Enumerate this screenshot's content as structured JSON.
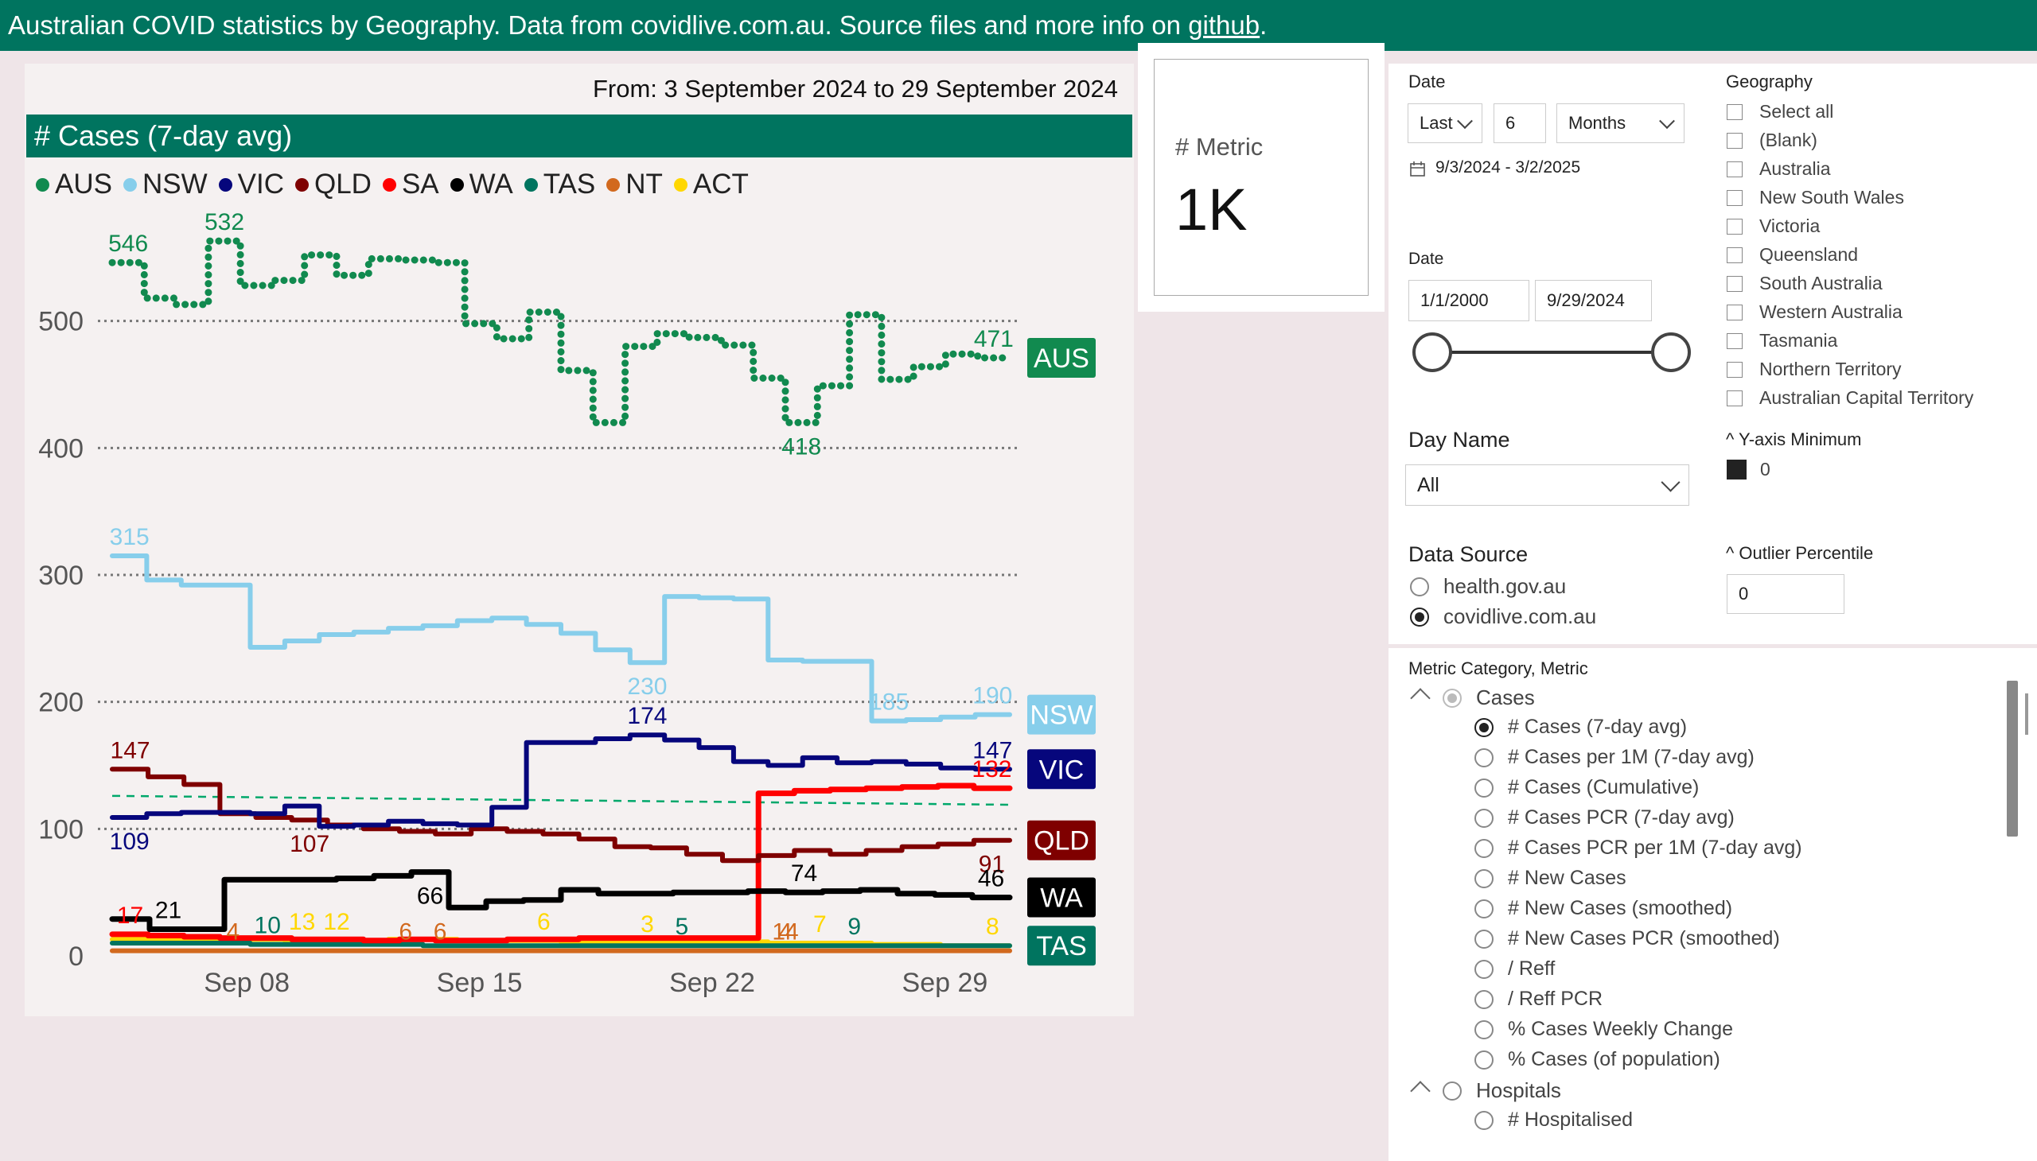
{
  "header": {
    "text_before_link": "Australian COVID statistics by Geography. Data from covidlive.com.au. Source files and more info on ",
    "link_text": "github",
    "text_after_link": "."
  },
  "chart": {
    "from_text": "From: 3 September 2024 to 29 September 2024",
    "title": "# Cases (7-day avg)"
  },
  "chart_data": {
    "type": "line",
    "title": "# Cases (7-day avg)",
    "xlabel": "",
    "ylabel": "",
    "x_ticks": [
      "Sep 08",
      "Sep 15",
      "Sep 22",
      "Sep 29"
    ],
    "y_ticks": [
      0,
      100,
      200,
      300,
      400,
      500
    ],
    "ylim": [
      0,
      600
    ],
    "grid": true,
    "legend_placement": "top",
    "reference_line": {
      "color": "#00a86b",
      "style": "dashed",
      "values": [
        126,
        119
      ]
    },
    "series": [
      {
        "name": "AUS",
        "color": "#118a4f",
        "values": [
          546,
          518,
          513,
          563,
          528,
          532,
          552,
          536,
          549,
          548,
          546,
          498,
          486,
          507,
          461,
          420,
          480,
          490,
          487,
          481,
          455,
          420,
          449,
          505,
          454,
          464,
          474,
          471
        ],
        "labels": [
          [
            0,
            "546"
          ],
          [
            3,
            "532"
          ],
          [
            21,
            "418"
          ],
          [
            27,
            "471"
          ]
        ],
        "end_label": "AUS"
      },
      {
        "name": "NSW",
        "color": "#87ceeb",
        "values": [
          315,
          296,
          292,
          292,
          243,
          248,
          253,
          255,
          258,
          260,
          264,
          266,
          261,
          254,
          241,
          231,
          283,
          282,
          281,
          233,
          232,
          232,
          185,
          186,
          188,
          190
        ],
        "labels": [
          [
            0,
            "315"
          ],
          [
            15,
            "230"
          ],
          [
            22,
            "185"
          ],
          [
            25,
            "190"
          ]
        ],
        "end_label": "NSW"
      },
      {
        "name": "VIC",
        "color": "#06067c",
        "values": [
          109,
          112,
          113,
          113,
          112,
          118,
          102,
          103,
          106,
          104,
          103,
          117,
          168,
          168,
          171,
          174,
          170,
          164,
          153,
          150,
          156,
          152,
          153,
          151,
          148,
          147
        ],
        "labels": [
          [
            0,
            "109"
          ],
          [
            15,
            "174"
          ],
          [
            25,
            "147"
          ]
        ],
        "end_label": "VIC"
      },
      {
        "name": "QLD",
        "color": "#7f0000",
        "values": [
          147,
          141,
          135,
          112,
          109,
          107,
          103,
          100,
          98,
          96,
          100,
          98,
          96,
          92,
          86,
          85,
          80,
          75,
          79,
          83,
          80,
          83,
          86,
          88,
          91
        ],
        "labels": [
          [
            0,
            "147"
          ],
          [
            5,
            "107"
          ],
          [
            24,
            "91"
          ]
        ],
        "end_label": "QLD"
      },
      {
        "name": "SA",
        "color": "#ff0000",
        "values": [
          17,
          16,
          15,
          14,
          14,
          13,
          13,
          12,
          13,
          12,
          12,
          13,
          13,
          14,
          14,
          14,
          14,
          14,
          128,
          130,
          131,
          132,
          133,
          134,
          132
        ],
        "labels": [
          [
            0,
            "17"
          ],
          [
            24,
            "132"
          ]
        ]
      },
      {
        "name": "WA",
        "color": "#000000",
        "values": [
          29,
          21,
          21,
          60,
          60,
          60,
          61,
          63,
          66,
          38,
          43,
          44,
          52,
          49,
          49,
          50,
          50,
          51,
          50,
          51,
          52,
          49,
          48,
          46
        ],
        "labels": [
          [
            1,
            "21"
          ],
          [
            8,
            "66"
          ],
          [
            18,
            "74"
          ],
          [
            23,
            "46"
          ]
        ],
        "end_label": "WA"
      },
      {
        "name": "TAS",
        "color": "#00745f",
        "values": [
          10,
          10,
          10,
          10,
          9,
          9,
          9,
          9,
          9,
          8,
          8,
          8,
          8,
          8,
          8,
          8,
          8,
          8,
          8,
          8,
          8,
          8,
          8,
          8,
          8,
          8
        ],
        "labels": [
          [
            4,
            "10"
          ],
          [
            16,
            "5"
          ],
          [
            21,
            "9"
          ]
        ],
        "end_label": "TAS"
      },
      {
        "name": "NT",
        "color": "#d2691e",
        "values": [
          4,
          4,
          4,
          4,
          4,
          4,
          4,
          4,
          4,
          4,
          4,
          4,
          4,
          4,
          4,
          4,
          4,
          4,
          4,
          4,
          4,
          4,
          4,
          4,
          4,
          4
        ],
        "labels": [
          [
            3,
            "4"
          ],
          [
            8,
            "6"
          ],
          [
            9,
            "6"
          ],
          [
            19,
            "4"
          ],
          [
            19,
            "14"
          ]
        ]
      },
      {
        "name": "ACT",
        "color": "#ffd700",
        "values": [
          13,
          13,
          13,
          13,
          13,
          12,
          12,
          12,
          13,
          13,
          12,
          12,
          12,
          11,
          11,
          10,
          10,
          11,
          11,
          10,
          10,
          10,
          9,
          9,
          8,
          8
        ],
        "labels": [
          [
            5,
            "13"
          ],
          [
            6,
            "12"
          ],
          [
            12,
            "6"
          ],
          [
            15,
            "3"
          ],
          [
            20,
            "7"
          ],
          [
            25,
            "8"
          ]
        ]
      }
    ]
  },
  "metric_card": {
    "label": "# Metric",
    "value": "1K"
  },
  "date_filter": {
    "title": "Date",
    "mode": "Last",
    "count": "6",
    "unit": "Months",
    "range": "9/3/2024 - 3/2/2025"
  },
  "date_range": {
    "title": "Date",
    "start": "1/1/2000",
    "end": "9/29/2024"
  },
  "day_name": {
    "title": "Day Name",
    "value": "All"
  },
  "data_source": {
    "title": "Data Source",
    "options": [
      {
        "label": "health.gov.au",
        "selected": false
      },
      {
        "label": "covidlive.com.au",
        "selected": true
      }
    ]
  },
  "geography": {
    "title": "Geography",
    "items": [
      "Select all",
      "(Blank)",
      "Australia",
      "New South Wales",
      "Victoria",
      "Queensland",
      "South Australia",
      "Western Australia",
      "Tasmania",
      "Northern Territory",
      "Australian Capital Territory"
    ]
  },
  "y_axis_min": {
    "title": "^ Y-axis Minimum",
    "value": "0",
    "swatch_color": "#222222"
  },
  "outlier": {
    "title": "^ Outlier Percentile",
    "value": "0"
  },
  "metric_category": {
    "title": "Metric Category, Metric",
    "groups": [
      {
        "label": "Cases",
        "items": [
          {
            "label": "# Cases (7-day avg)",
            "selected": true
          },
          {
            "label": "# Cases per 1M (7-day avg)",
            "selected": false
          },
          {
            "label": "# Cases (Cumulative)",
            "selected": false
          },
          {
            "label": "# Cases PCR (7-day avg)",
            "selected": false
          },
          {
            "label": "# Cases PCR per 1M (7-day avg)",
            "selected": false
          },
          {
            "label": "# New Cases",
            "selected": false
          },
          {
            "label": "# New Cases (smoothed)",
            "selected": false
          },
          {
            "label": "# New Cases PCR (smoothed)",
            "selected": false
          },
          {
            "label": "/ Reff",
            "selected": false
          },
          {
            "label": "/ Reff PCR",
            "selected": false
          },
          {
            "label": "% Cases Weekly Change",
            "selected": false
          },
          {
            "label": "% Cases (of population)",
            "selected": false
          }
        ]
      },
      {
        "label": "Hospitals",
        "items": [
          {
            "label": "# Hospitalised",
            "selected": false
          }
        ]
      }
    ]
  }
}
